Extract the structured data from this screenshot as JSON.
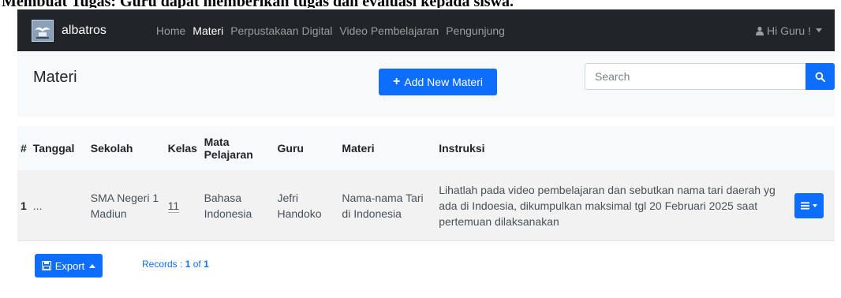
{
  "caption": "Membuat Tugas: Guru dapat memberikan tugas dan evaluasi kepada siswa.",
  "navbar": {
    "brand": "albatros",
    "links": [
      {
        "label": "Home",
        "active": false
      },
      {
        "label": "Materi",
        "active": true
      },
      {
        "label": "Perpustakaan Digital",
        "active": false
      },
      {
        "label": "Video Pembelajaran",
        "active": false
      },
      {
        "label": "Pengunjung",
        "active": false
      }
    ],
    "user": "Hi Guru !"
  },
  "panel": {
    "title": "Materi",
    "add_button": "Add New Materi",
    "search_placeholder": "Search"
  },
  "table": {
    "headers": [
      "#",
      "Tanggal",
      "Sekolah",
      "Kelas",
      "Mata Pelajaran",
      "Guru",
      "Materi",
      "Instruksi"
    ],
    "rows": [
      {
        "no": "1",
        "tanggal": "...",
        "sekolah": "SMA Negeri 1 Madiun",
        "kelas": "11",
        "mapel": "Bahasa Indonesia",
        "guru": "Jefri Handoko",
        "materi": "Nama-nama Tari di Indonesia",
        "instruksi": "Lihatlah pada video pembelajaran dan sebutkan nama tari daerah yg ada di Indoesia, dikumpulkan maksimal tgl 20 Februari 2025 saat pertemuan dilaksanakan"
      }
    ]
  },
  "footer": {
    "export_label": "Export",
    "records_label": "Records :",
    "records_current": "1",
    "records_of": "of",
    "records_total": "1"
  },
  "colors": {
    "primary": "#0d6efd",
    "navbar": "#212529",
    "panel": "#f8f9fa"
  }
}
